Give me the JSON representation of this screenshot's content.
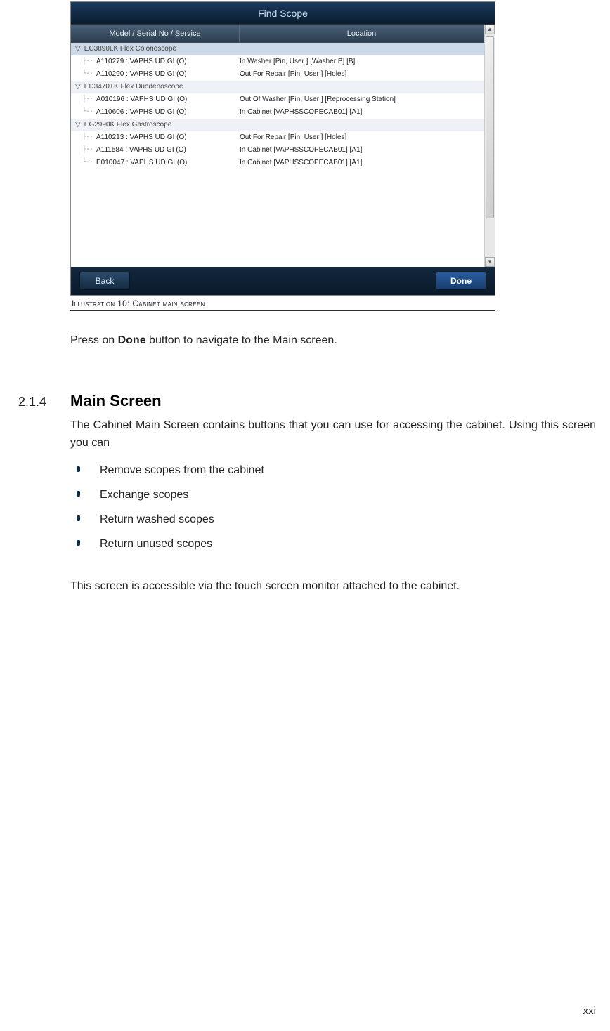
{
  "app": {
    "title": "Find Scope",
    "columns": {
      "model": "Model / Serial No / Service",
      "location": "Location"
    },
    "groups": [
      {
        "label": "EC3890LK Flex Colonoscope",
        "selected": true,
        "items": [
          {
            "model": "A110279 : VAPHS UD GI (O)",
            "location": "In Washer [Pin, User ] [Washer B] [B]"
          },
          {
            "model": "A110290 : VAPHS UD GI (O)",
            "location": "Out For Repair [Pin, User ] [Holes]"
          }
        ]
      },
      {
        "label": "ED3470TK Flex Duodenoscope",
        "selected": false,
        "items": [
          {
            "model": "A010196 : VAPHS UD GI (O)",
            "location": "Out Of Washer [Pin, User ] [Reprocessing Station]"
          },
          {
            "model": "A110606 : VAPHS UD GI (O)",
            "location": "In Cabinet [VAPHSSCOPECAB01] [A1]"
          }
        ]
      },
      {
        "label": "EG2990K Flex Gastroscope",
        "selected": false,
        "items": [
          {
            "model": "A110213 : VAPHS UD GI (O)",
            "location": "Out For Repair [Pin, User ] [Holes]"
          },
          {
            "model": "A111584 : VAPHS UD GI (O)",
            "location": "In Cabinet [VAPHSSCOPECAB01] [A1]"
          },
          {
            "model": "E010047 : VAPHS UD GI (O)",
            "location": "In Cabinet [VAPHSSCOPECAB01] [A1]"
          }
        ]
      }
    ],
    "buttons": {
      "back": "Back",
      "done": "Done"
    }
  },
  "caption": {
    "prefix": "Illustration ",
    "number": "10",
    "separator": ": ",
    "text": "Cabinet main screen"
  },
  "instruction": {
    "pre": "Press on ",
    "bold": "Done",
    "post": " button to navigate to the Main screen."
  },
  "section": {
    "number": "2.1.4",
    "title": "Main Screen",
    "intro": "The Cabinet Main Screen contains buttons that you can use for accessing the cabinet. Using this screen you can",
    "bullets": [
      "Remove scopes from the cabinet",
      "Exchange scopes",
      "Return washed scopes",
      "Return unused scopes"
    ],
    "closing": "This screen is accessible via the touch screen monitor attached to the cabinet."
  },
  "page_number": "xxi"
}
